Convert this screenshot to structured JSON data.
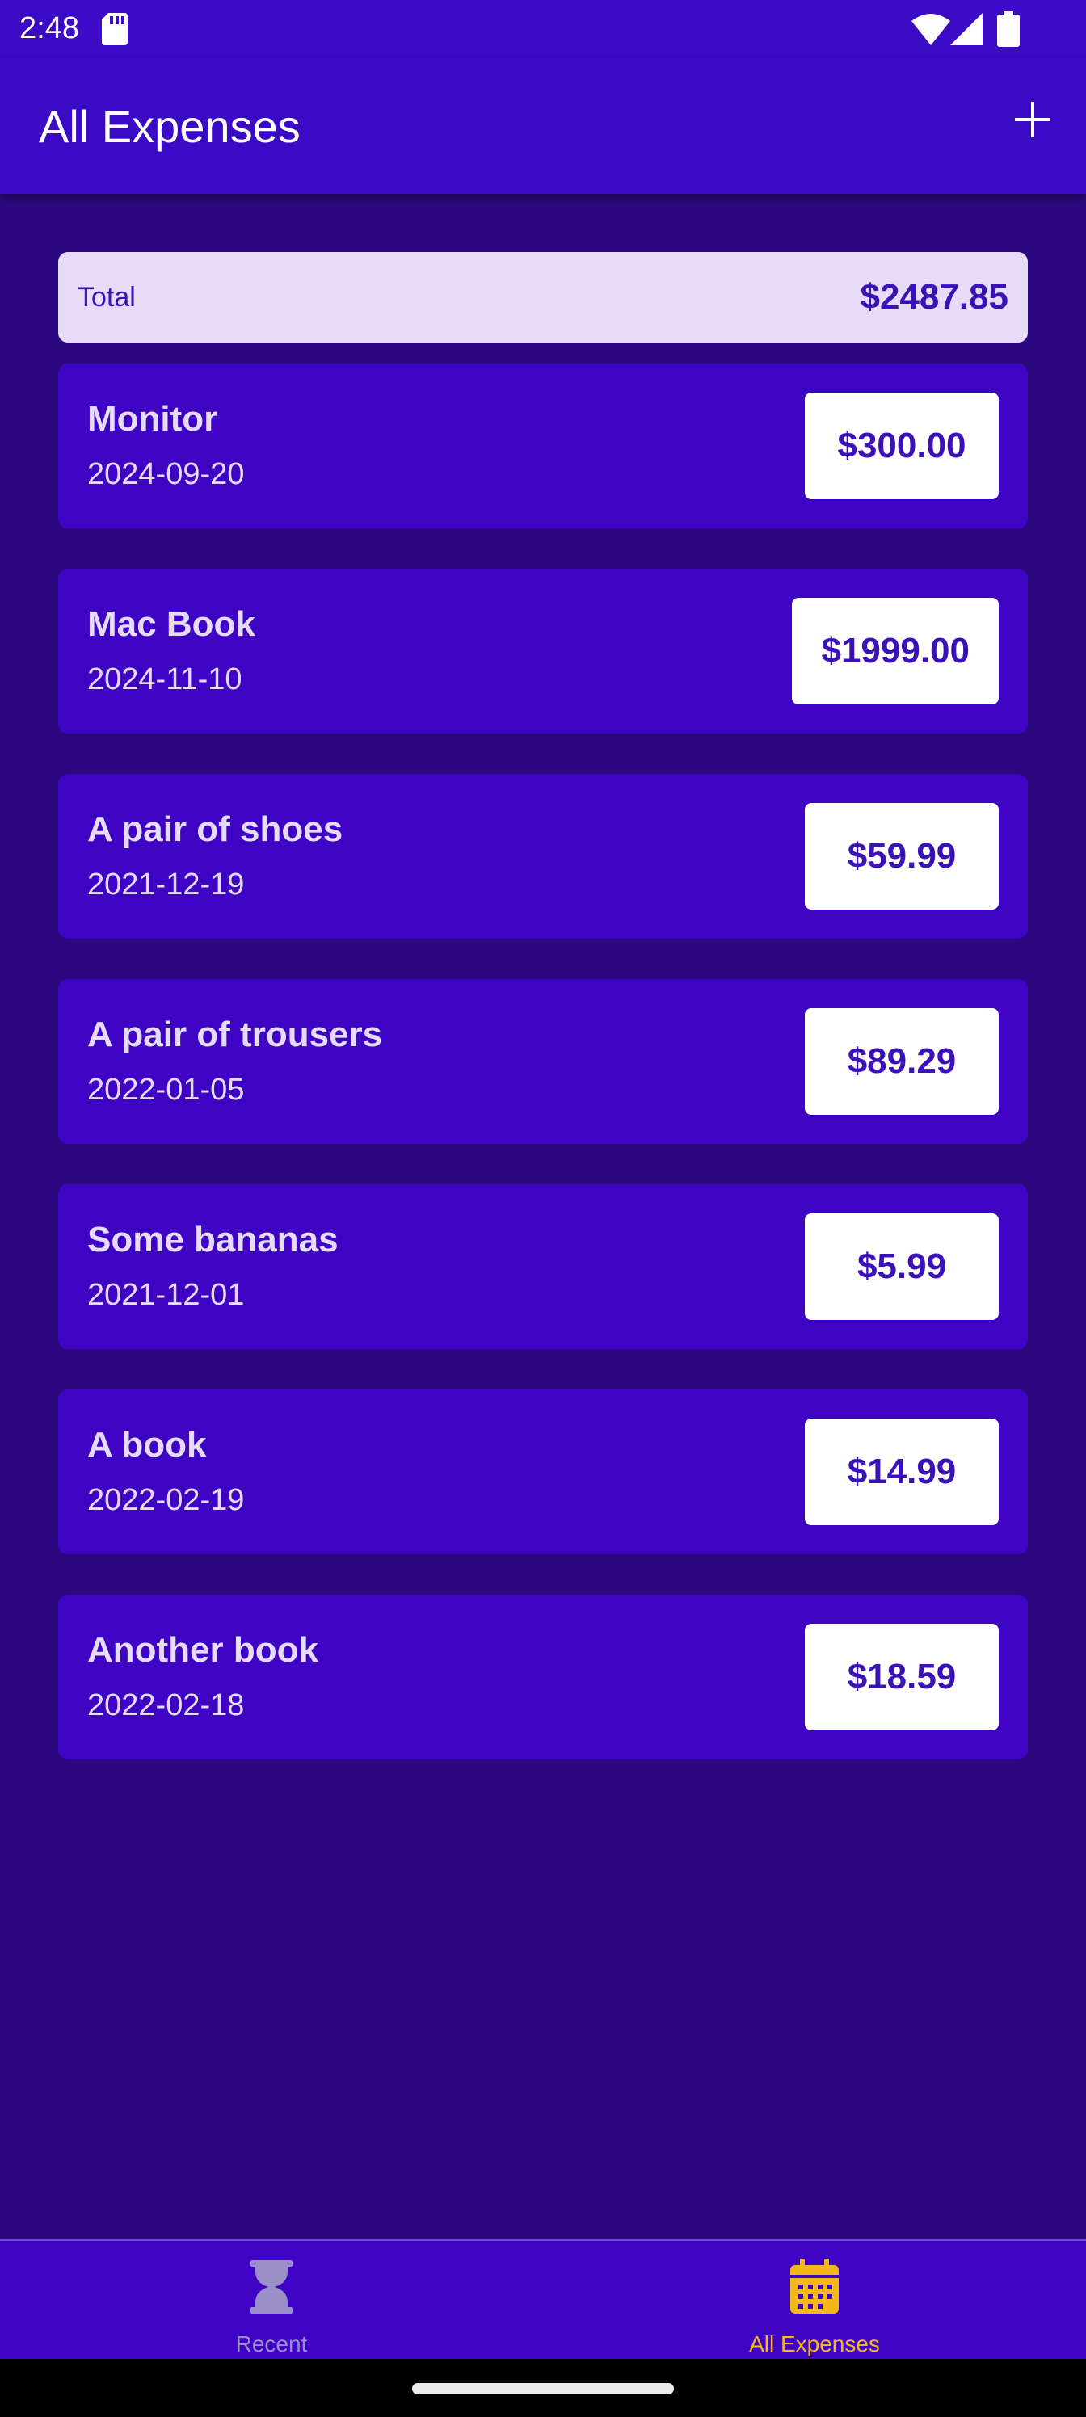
{
  "status_bar": {
    "time": "2:48"
  },
  "app_bar": {
    "title": "All Expenses",
    "add_icon": "plus-icon"
  },
  "summary": {
    "label": "Total",
    "value": "$2487.85"
  },
  "expenses": [
    {
      "title": "Monitor",
      "date": "2024-09-20",
      "amount": "$300.00"
    },
    {
      "title": "Mac Book",
      "date": "2024-11-10",
      "amount": "$1999.00"
    },
    {
      "title": "A pair of shoes",
      "date": "2021-12-19",
      "amount": "$59.99"
    },
    {
      "title": "A pair of trousers",
      "date": "2022-01-05",
      "amount": "$89.29"
    },
    {
      "title": "Some bananas",
      "date": "2021-12-01",
      "amount": "$5.99"
    },
    {
      "title": "A book",
      "date": "2022-02-19",
      "amount": "$14.99"
    },
    {
      "title": "Another book",
      "date": "2022-02-18",
      "amount": "$18.59"
    }
  ],
  "bottom_nav": {
    "items": [
      {
        "label": "Recent",
        "icon": "hourglass-icon",
        "active": false
      },
      {
        "label": "All Expenses",
        "icon": "calendar-icon",
        "active": true
      }
    ]
  },
  "colors": {
    "app_bar": "#3a0ac4",
    "background": "#2c0880",
    "card": "#3e03c3",
    "total_card": "#e6dcfa",
    "text_light": "#e6dcfa",
    "amount_text": "#3a12b8",
    "accent": "#f4b81b",
    "muted": "#9a8fc8"
  }
}
